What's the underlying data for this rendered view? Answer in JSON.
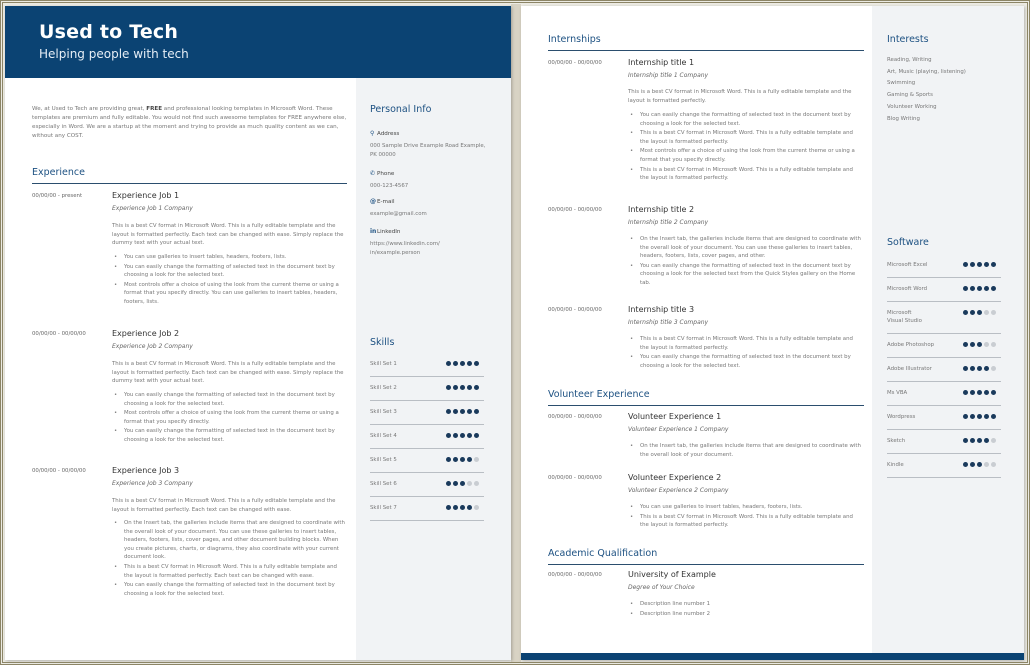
{
  "header": {
    "title": "Used to Tech",
    "subtitle": "Helping people with tech"
  },
  "intro": {
    "before_free": "We, at Used to Tech are providing great, ",
    "free1": "FREE",
    "middle": " and professional looking templates in Microsoft Word. These templates are premium and fully editable. You would not find such awesome templates for FREE anywhere else, especially in Word. We are a startup at the moment and trying to provide as much quality content as we can, without any COST."
  },
  "experience": {
    "title": "Experience",
    "items": [
      {
        "date": "00/00/00 - present",
        "job": "Experience Job 1",
        "company": "Experience  Job 1 Company",
        "desc": "This is a best CV format in Microsoft Word. This is a fully editable template and the layout is formatted perfectly. Each text can be changed with ease. Simply replace the dummy text with your actual text.",
        "bullets": [
          "You can use galleries to insert tables, headers, footers, lists.",
          "You can easily change the formatting of selected text in the document text by choosing a look for the selected text.",
          "Most controls offer a choice of using the look from the current theme or using a format that you specify directly. You can use galleries to insert tables, headers, footers, lists."
        ]
      },
      {
        "date": "00/00/00 - 00/00/00",
        "job": "Experience Job 2",
        "company": "Experience  Job 2 Company",
        "desc": "This is a best CV format in Microsoft Word. This is a fully editable template and the layout is formatted perfectly. Each text can be changed with ease. Simply replace the dummy text with your actual text.",
        "bullets": [
          "You can easily change the formatting of selected text in the document text by choosing a look for the selected text.",
          "Most controls offer a choice of using the look from the current theme or using a format that you specify directly.",
          "You can easily change the formatting of selected text in the document text by choosing a look for the selected text."
        ]
      },
      {
        "date": "00/00/00 - 00/00/00",
        "job": "Experience Job 3",
        "company": "Experience  Job 3 Company",
        "desc": "This is a best CV format in Microsoft Word. This is a fully editable template and the layout is formatted perfectly. Each text can be changed with ease.",
        "bullets": [
          "On the Insert tab, the galleries include items that are designed to coordinate with the overall look of your document. You can use these galleries to insert tables, headers, footers, lists, cover pages, and other document building blocks. When you create pictures, charts, or diagrams, they also coordinate with your current document look.",
          "This is a best CV format in Microsoft Word. This is a fully editable template and the layout is formatted perfectly. Each text can be changed with ease.",
          "You can easily change the formatting of selected text in the document text by choosing a look for the selected text."
        ]
      }
    ]
  },
  "personal_info": {
    "title": "Personal Info",
    "address_label": "Address",
    "address_value": "000 Sample Drive Example Road Example, PK 00000",
    "phone_label": "Phone",
    "phone_value": "000-123-4567",
    "email_label": "E-mail",
    "email_value": "example@gmail.com",
    "linkedin_label": "LinkedIn",
    "linkedin_value": "https://www.linkedin.com/ in/example.person",
    "icons": {
      "address": "map-pin-icon",
      "phone": "phone-icon",
      "email": "at-icon",
      "linkedin": "linkedin-icon"
    }
  },
  "skills": {
    "title": "Skills",
    "items": [
      {
        "label": "Skill Set 1",
        "rating": 5,
        "max": 5
      },
      {
        "label": "Skill Set 2",
        "rating": 5,
        "max": 5
      },
      {
        "label": "Skill Set 3",
        "rating": 5,
        "max": 5
      },
      {
        "label": "Skill Set 4",
        "rating": 5,
        "max": 5
      },
      {
        "label": "Skill Set 5",
        "rating": 4,
        "max": 5
      },
      {
        "label": "Skill Set 6",
        "rating": 3,
        "max": 5
      },
      {
        "label": "Skill Set 7",
        "rating": 4,
        "max": 5
      }
    ]
  },
  "internships": {
    "title": "Internships",
    "items": [
      {
        "date": "00/00/00 - 00/00/00",
        "job": "Internship title 1",
        "company": "Internship  title 1 Company",
        "desc": "This is a best CV format in Microsoft Word. This is a fully editable template and the layout is formatted perfectly.",
        "bullets": [
          "You can easily change the formatting of selected text in the document text by choosing a look for the selected text.",
          "This is a best CV format in Microsoft Word. This is a fully editable template and the layout is formatted perfectly.",
          "Most controls offer a choice of using the look from the current theme or using a format that you specify directly.",
          "This is a best CV format in Microsoft Word. This is a fully editable template and the layout is formatted perfectly."
        ]
      },
      {
        "date": "00/00/00 - 00/00/00",
        "job": "Internship title 2",
        "company": "Internship  title 2 Company",
        "bullets": [
          "On the Insert tab, the galleries include items that are designed to coordinate with the overall look of your document. You can use these galleries to insert tables, headers, footers, lists, cover pages, and other.",
          "You can easily change the formatting of selected text in the document text by choosing a look for the selected text from the Quick Styles gallery on the Home tab."
        ]
      },
      {
        "date": "00/00/00 - 00/00/00",
        "job": "Internship title 3",
        "company": "Internship  title 3 Company",
        "bullets": [
          "This is a best CV format in Microsoft Word. This is a fully editable template and the layout is formatted perfectly.",
          "You can easily change the formatting of selected text in the document text by choosing a look for the selected text."
        ]
      }
    ]
  },
  "volunteer": {
    "title": "Volunteer Experience",
    "items": [
      {
        "date": "00/00/00 - 00/00/00",
        "job": "Volunteer Experience 1",
        "company": "Volunteer  Experience  1 Company",
        "bullets": [
          "On the Insert tab, the galleries include items that are designed to coordinate with the overall look of your document."
        ]
      },
      {
        "date": "00/00/00 - 00/00/00",
        "job": "Volunteer Experience 2",
        "company": "Volunteer  Experience  2 Company",
        "bullets": [
          "You can use galleries to insert tables, headers, footers, lists.",
          "This is a best CV format in Microsoft Word. This is a fully editable template and the layout is formatted perfectly."
        ]
      }
    ]
  },
  "academic": {
    "title": "Academic Qualification",
    "items": [
      {
        "date": "00/00/00 - 00/00/00",
        "job": "University of Example",
        "company": "Degree of Your Choice",
        "bullets": [
          "Description line number 1",
          "Description line number 2"
        ]
      }
    ]
  },
  "interests": {
    "title": "Interests",
    "items": [
      "Reading, Writing",
      "Art, Music (playing, listening)",
      "Swimming",
      "Gaming & Sports",
      "Volunteer Working",
      "Blog Writing"
    ]
  },
  "software": {
    "title": "Software",
    "items": [
      {
        "label": "Microsoft Excel",
        "rating": 5,
        "max": 5
      },
      {
        "label": "Microsoft Word",
        "rating": 5,
        "max": 5
      },
      {
        "label": "Microsoft Visual Studio",
        "rating": 3,
        "max": 5
      },
      {
        "label": "Adobe Photoshop",
        "rating": 3,
        "max": 5
      },
      {
        "label": "Adobe Illustrator",
        "rating": 4,
        "max": 5
      },
      {
        "label": "Ms VBA",
        "rating": 5,
        "max": 5
      },
      {
        "label": "Wordpress",
        "rating": 5,
        "max": 5
      },
      {
        "label": "Sketch",
        "rating": 4,
        "max": 5
      },
      {
        "label": "Kindle",
        "rating": 3,
        "max": 5
      }
    ]
  },
  "colors": {
    "brand": "#0b4373",
    "heading": "#1d5182",
    "dot_on": "#1a3a5c",
    "dot_off": "#c9cdd2",
    "sidebar_bg": "#f1f3f5"
  }
}
